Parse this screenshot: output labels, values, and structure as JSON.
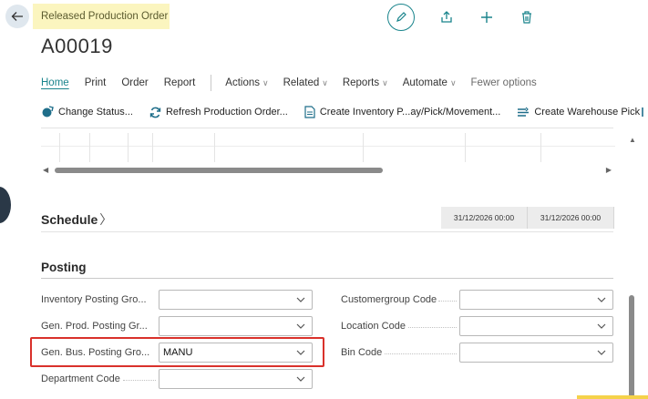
{
  "header": {
    "caption": "Released Production Order",
    "title": "A00019"
  },
  "icons": {
    "back": "back-arrow-icon",
    "edit": "pencil-icon",
    "share": "share-icon",
    "new": "plus-icon",
    "delete": "trash-icon"
  },
  "actionbar": {
    "tabs": [
      "Home",
      "Print",
      "Order",
      "Report"
    ],
    "menus": [
      "Actions",
      "Related",
      "Reports",
      "Automate"
    ],
    "fewer_options": "Fewer options"
  },
  "toolbar": {
    "change_status": "Change Status...",
    "refresh": "Refresh Production Order...",
    "create_inventory": "Create Inventory P...ay/Pick/Movement...",
    "create_warehouse": "Create Warehouse Pick"
  },
  "schedule": {
    "title": "Schedule",
    "cells": [
      "31/12/2026 00:00",
      "31/12/2026 00:00"
    ]
  },
  "posting": {
    "title": "Posting",
    "left_fields": [
      {
        "label": "Inventory Posting Gro...",
        "value": ""
      },
      {
        "label": "Gen. Prod. Posting Gr...",
        "value": ""
      },
      {
        "label": "Gen. Bus. Posting Gro...",
        "value": "MANU"
      },
      {
        "label": "Department Code",
        "value": ""
      }
    ],
    "right_fields": [
      {
        "label": "Customergroup Code",
        "value": ""
      },
      {
        "label": "Location Code",
        "value": ""
      },
      {
        "label": "Bin Code",
        "value": ""
      }
    ]
  },
  "colors": {
    "accent": "#19848c",
    "caption_bg": "#fbf5bf",
    "highlight": "#d9312b"
  }
}
